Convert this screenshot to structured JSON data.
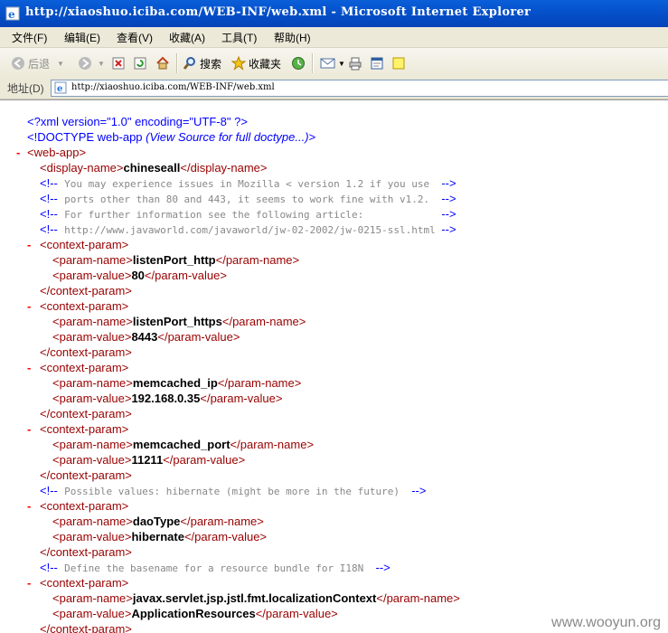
{
  "window": {
    "title": "http://xiaoshuo.iciba.com/WEB-INF/web.xml - Microsoft Internet Explorer"
  },
  "menu": [
    "文件(F)",
    "编辑(E)",
    "查看(V)",
    "收藏(A)",
    "工具(T)",
    "帮助(H)"
  ],
  "toolbar": {
    "back": "后退",
    "search": "搜索",
    "favorites": "收藏夹"
  },
  "address": {
    "label": "地址(D)",
    "url": "http://xiaoshuo.iciba.com/WEB-INF/web.xml"
  },
  "xml": {
    "decl": "<?xml version=\"1.0\" encoding=\"UTF-8\" ?>",
    "doctype": "<!DOCTYPE web-app",
    "doctype_note": "(View Source for full doctype...)",
    "doctype_close": ">",
    "webapp_open": "<web-app>",
    "display_open": "<display-name>",
    "display_value": "chineseall",
    "display_close": "</display-name>",
    "cm_open": "<!--",
    "cm_close": "-->",
    "comments_top": [
      "You may experience issues in Mozilla < version 1.2 if you use  ",
      "ports other than 80 and 443, it seems to work fine with v1.2.  ",
      "For further information see the following article:             ",
      "http://www.javaworld.com/javaworld/jw-02-2002/jw-0215-ssl.html "
    ],
    "cp_open": "<context-param>",
    "cp_close": "</context-param>",
    "pn_open": "<param-name>",
    "pn_close": "</param-name>",
    "pv_open": "<param-value>",
    "pv_close": "</param-value>",
    "params": [
      {
        "name": "listenPort_http",
        "value": "80"
      },
      {
        "name": "listenPort_https",
        "value": "8443"
      },
      {
        "name": "memcached_ip",
        "value": "192.168.0.35"
      },
      {
        "name": "memcached_port",
        "value": "11211"
      },
      {
        "name": "daoType",
        "value": "hibernate"
      },
      {
        "name": "javax.servlet.jsp.jstl.fmt.localizationContext",
        "value": "ApplicationResources"
      }
    ],
    "comment_possible": "Possible values: hibernate (might be more in the future)  ",
    "comment_basename": "Define the basename for a resource bundle for I18N  "
  },
  "watermark": "www.wooyun.org"
}
